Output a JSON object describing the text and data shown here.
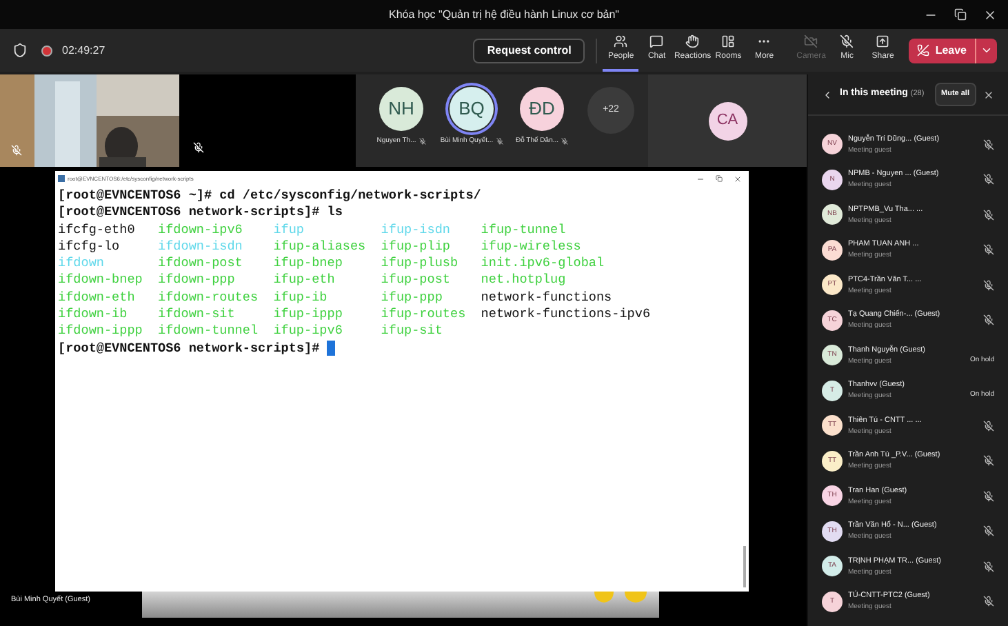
{
  "window": {
    "title": "Khóa học \"Quản trị hệ điều hành Linux cơ bản\""
  },
  "toolbar": {
    "timer": "02:49:27",
    "request_control": "Request control",
    "actions": [
      {
        "kind": "people",
        "label": "People",
        "selected": true,
        "disabled": false
      },
      {
        "kind": "chat",
        "label": "Chat",
        "selected": false,
        "disabled": false
      },
      {
        "kind": "reactions",
        "label": "Reactions",
        "selected": false,
        "disabled": false
      },
      {
        "kind": "rooms",
        "label": "Rooms",
        "selected": false,
        "disabled": false
      },
      {
        "kind": "more",
        "label": "More",
        "selected": false,
        "disabled": false
      },
      {
        "kind": "camera",
        "label": "Camera",
        "selected": false,
        "disabled": true
      },
      {
        "kind": "mic",
        "label": "Mic",
        "selected": false,
        "disabled": false
      },
      {
        "kind": "share",
        "label": "Share",
        "selected": false,
        "disabled": false
      }
    ],
    "leave": "Leave"
  },
  "gallery": [
    {
      "initials": "NH",
      "name": "Nguyen Th...",
      "color": "#d9ead9",
      "selected": false
    },
    {
      "initials": "BQ",
      "name": "Bùi Minh Quyết...",
      "color": "#d6efee",
      "selected": true
    },
    {
      "initials": "ĐD",
      "name": "Đỗ Thế Dân...",
      "color": "#f7d2dc",
      "selected": false
    }
  ],
  "overflow_count": "+22",
  "spotlight_initials": "CA",
  "terminal": {
    "title": "root@EVNCENTOS6:/etc/sysconfig/network-scripts",
    "commands": [
      "[root@EVNCENTOS6 ~]# cd /etc/sysconfig/network-scripts/",
      "[root@EVNCENTOS6 network-scripts]# ls"
    ],
    "listing": [
      [
        {
          "name": "ifcfg-eth0",
          "kind": "file"
        },
        {
          "name": "ifdown-ipv6",
          "kind": "exec"
        },
        {
          "name": "ifup",
          "kind": "link"
        },
        {
          "name": "ifup-isdn",
          "kind": "link"
        },
        {
          "name": "ifup-tunnel",
          "kind": "exec"
        }
      ],
      [
        {
          "name": "ifcfg-lo",
          "kind": "file"
        },
        {
          "name": "ifdown-isdn",
          "kind": "link"
        },
        {
          "name": "ifup-aliases",
          "kind": "exec"
        },
        {
          "name": "ifup-plip",
          "kind": "exec"
        },
        {
          "name": "ifup-wireless",
          "kind": "exec"
        }
      ],
      [
        {
          "name": "ifdown",
          "kind": "link"
        },
        {
          "name": "ifdown-post",
          "kind": "exec"
        },
        {
          "name": "ifup-bnep",
          "kind": "exec"
        },
        {
          "name": "ifup-plusb",
          "kind": "exec"
        },
        {
          "name": "init.ipv6-global",
          "kind": "exec"
        }
      ],
      [
        {
          "name": "ifdown-bnep",
          "kind": "exec"
        },
        {
          "name": "ifdown-ppp",
          "kind": "exec"
        },
        {
          "name": "ifup-eth",
          "kind": "exec"
        },
        {
          "name": "ifup-post",
          "kind": "exec"
        },
        {
          "name": "net.hotplug",
          "kind": "exec"
        }
      ],
      [
        {
          "name": "ifdown-eth",
          "kind": "exec"
        },
        {
          "name": "ifdown-routes",
          "kind": "exec"
        },
        {
          "name": "ifup-ib",
          "kind": "exec"
        },
        {
          "name": "ifup-ppp",
          "kind": "exec"
        },
        {
          "name": "network-functions",
          "kind": "file"
        }
      ],
      [
        {
          "name": "ifdown-ib",
          "kind": "exec"
        },
        {
          "name": "ifdown-sit",
          "kind": "exec"
        },
        {
          "name": "ifup-ippp",
          "kind": "exec"
        },
        {
          "name": "ifup-routes",
          "kind": "exec"
        },
        {
          "name": "network-functions-ipv6",
          "kind": "file"
        }
      ],
      [
        {
          "name": "ifdown-ippp",
          "kind": "exec"
        },
        {
          "name": "ifdown-tunnel",
          "kind": "exec"
        },
        {
          "name": "ifup-ipv6",
          "kind": "exec"
        },
        {
          "name": "ifup-sit",
          "kind": "exec"
        }
      ]
    ],
    "prompt": "[root@EVNCENTOS6 network-scripts]#"
  },
  "presenter": "Bùi Minh Quyết (Guest)",
  "panel": {
    "title": "In this meeting",
    "count": "(28)",
    "mute_all": "Mute all",
    "participants": [
      {
        "initials": "NV",
        "name": "Nguyễn Trí Dũng... (Guest)",
        "role": "Meeting guest",
        "kind": "muted",
        "color": "#f6d3d9"
      },
      {
        "initials": "N",
        "name": "NPMB - Nguyen ... (Guest)",
        "role": "Meeting guest",
        "kind": "muted",
        "color": "#ead6ee"
      },
      {
        "initials": "NB",
        "name": "NPTPMB_Vu Tha... ...",
        "role": "Meeting guest",
        "kind": "muted",
        "color": "#e0ead9"
      },
      {
        "initials": "PA",
        "name": "PHAM TUAN ANH ...",
        "role": "Meeting guest",
        "kind": "muted",
        "color": "#fbdcd3"
      },
      {
        "initials": "PT",
        "name": "PTC4-Trần Văn T... ...",
        "role": "Meeting guest",
        "kind": "muted",
        "color": "#fbe8c8"
      },
      {
        "initials": "TC",
        "name": "Tạ Quang Chiến-... (Guest)",
        "role": "Meeting guest",
        "kind": "muted",
        "color": "#f6d3d9"
      },
      {
        "initials": "TN",
        "name": "Thanh Nguyễn (Guest)",
        "role": "Meeting guest",
        "kind": "on_hold",
        "status": "On hold",
        "color": "#d9ead9"
      },
      {
        "initials": "T",
        "name": "Thanhvv (Guest)",
        "role": "Meeting guest",
        "kind": "on_hold",
        "status": "On hold",
        "color": "#d6ece6"
      },
      {
        "initials": "TT",
        "name": "Thiên Tú - CNTT ... ...",
        "role": "Meeting guest",
        "kind": "muted",
        "color": "#fbe0cc"
      },
      {
        "initials": "TT",
        "name": "Trần Anh Tú _P.V... (Guest)",
        "role": "Meeting guest",
        "kind": "muted",
        "color": "#fbefc8"
      },
      {
        "initials": "TH",
        "name": "Tran Han (Guest)",
        "role": "Meeting guest",
        "kind": "muted",
        "color": "#f8d4e4"
      },
      {
        "initials": "TH",
        "name": "Trần Văn Hổ - N... (Guest)",
        "role": "Meeting guest",
        "kind": "muted",
        "color": "#e2dcf2"
      },
      {
        "initials": "TA",
        "name": "TRỊNH PHẠM TR... (Guest)",
        "role": "Meeting guest",
        "kind": "muted",
        "color": "#d2ece9"
      },
      {
        "initials": "T",
        "name": "TÚ-CNTT-PTC2 (Guest)",
        "role": "Meeting guest",
        "kind": "muted",
        "color": "#f6d3d9"
      }
    ]
  }
}
